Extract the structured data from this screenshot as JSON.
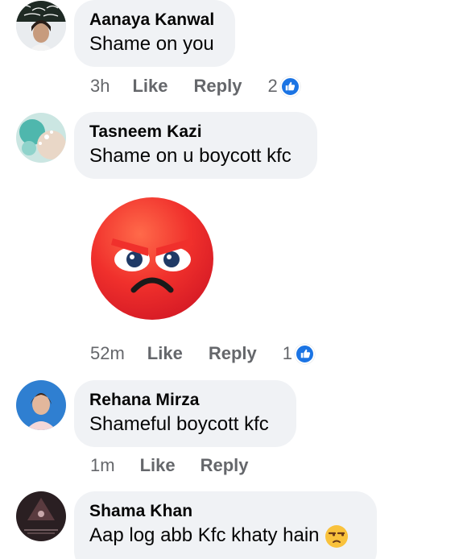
{
  "comments": [
    {
      "name": "Aanaya Kanwal",
      "text": "Shame on you",
      "time": "3h",
      "like_label": "Like",
      "reply_label": "Reply",
      "reaction_count": "2"
    },
    {
      "name": "Tasneem Kazi",
      "text": "Shame on u boycott kfc",
      "sticker": "angry-face-sticker",
      "time": "52m",
      "like_label": "Like",
      "reply_label": "Reply",
      "reaction_count": "1"
    },
    {
      "name": "Rehana Mirza",
      "text": "Shameful boycott kfc",
      "time": "1m",
      "like_label": "Like",
      "reply_label": "Reply"
    },
    {
      "name": "Shama Khan",
      "text": "Aap log abb Kfc khaty hain",
      "emoji": "unamused-face-emoji"
    }
  ],
  "colors": {
    "bubble": "#f0f2f5",
    "meta_text": "#65676b",
    "like_blue": "#1b74e4",
    "angry_red": "#f0302c"
  }
}
